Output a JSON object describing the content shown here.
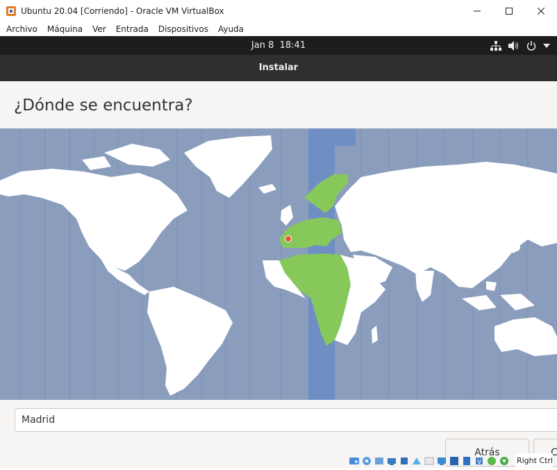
{
  "window": {
    "title": "Ubuntu 20.04 [Corriendo] - Oracle VM VirtualBox"
  },
  "menubar": {
    "items": [
      {
        "label": "Archivo"
      },
      {
        "label": "Máquina"
      },
      {
        "label": "Ver"
      },
      {
        "label": "Entrada"
      },
      {
        "label": "Dispositivos"
      },
      {
        "label": "Ayuda"
      }
    ]
  },
  "topbar": {
    "date": "Jan 8",
    "time": "18:41",
    "tray_icons": [
      "network-icon",
      "volume-icon",
      "power-icon",
      "chevron-down-icon"
    ]
  },
  "installer": {
    "header_title": "Instalar",
    "heading": "¿Dónde se encuentra?",
    "timezone_value": "Madrid",
    "back_label": "Atrás",
    "next_label": "C"
  },
  "colors": {
    "ocean": "#8a9dbd",
    "land": "#ffffff",
    "selected_band": "#6f8ec4",
    "selected_land": "#86c95a",
    "location_marker": "#e8563b"
  },
  "statusbar": {
    "host_key": "Right Ctrl",
    "icons": [
      "hard-disk-icon",
      "optical-drive-icon",
      "audio-icon",
      "network-adapter-icon",
      "usb-icon",
      "shared-folders-icon",
      "display-icon",
      "screen-icon",
      "capture-icon",
      "recording-icon",
      "cpu-icon",
      "mouse-integration-icon",
      "keyboard-icon"
    ]
  }
}
